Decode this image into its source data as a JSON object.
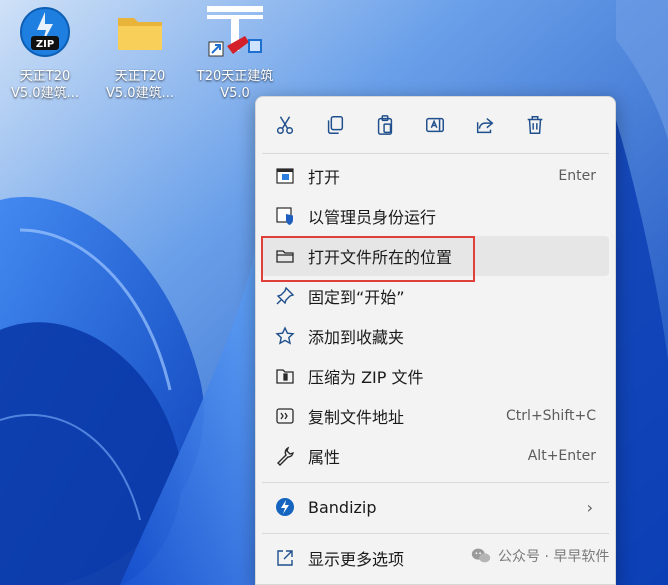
{
  "desktop": {
    "icons": [
      {
        "line1": "天正T20",
        "line2": "V5.0建筑..."
      },
      {
        "line1": "天正T20",
        "line2": "V5.0建筑..."
      },
      {
        "line1": "T20天正建筑",
        "line2": "V5.0"
      }
    ]
  },
  "context_menu": {
    "toolbar": [
      "cut-icon",
      "copy-icon",
      "paste-icon",
      "rename-icon",
      "share-icon",
      "delete-icon"
    ],
    "items": [
      {
        "label": "打开",
        "shortcut": "Enter",
        "icon": "open-app-icon"
      },
      {
        "label": "以管理员身份运行",
        "shortcut": "",
        "icon": "admin-shield-icon"
      },
      {
        "label": "打开文件所在的位置",
        "shortcut": "",
        "icon": "folder-icon"
      },
      {
        "label": "固定到“开始”",
        "shortcut": "",
        "icon": "pin-icon"
      },
      {
        "label": "添加到收藏夹",
        "shortcut": "",
        "icon": "star-icon"
      },
      {
        "label": "压缩为 ZIP 文件",
        "shortcut": "",
        "icon": "zip-icon"
      },
      {
        "label": "复制文件地址",
        "shortcut": "Ctrl+Shift+C",
        "icon": "copy-path-icon"
      },
      {
        "label": "属性",
        "shortcut": "Alt+Enter",
        "icon": "wrench-icon"
      },
      {
        "label": "Bandizip",
        "shortcut": "",
        "icon": "bandizip-icon"
      },
      {
        "label": "显示更多选项",
        "shortcut": "",
        "icon": "more-options-icon"
      }
    ]
  },
  "watermark": {
    "text": "公众号 · 早早软件"
  },
  "colors": {
    "accent": "#0067c0",
    "highlight_border": "#e0403a",
    "menu_bg": "#f3f3f3"
  }
}
